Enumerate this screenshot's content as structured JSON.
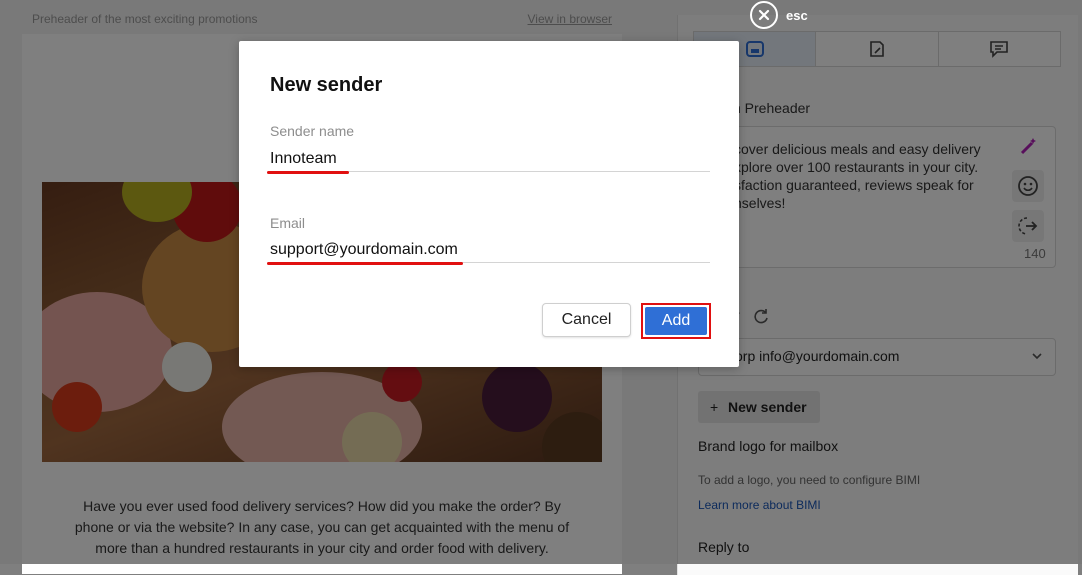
{
  "page": {
    "preheader_label": "Preheader of the most exciting promotions",
    "view_in_browser": "View in browser",
    "email_body": "Have you ever used food delivery services? How did you make the order? By phone or via the website? In any case, you can get acquainted with the menu of more than a hundred restaurants in your city and order food with delivery."
  },
  "sidebar": {
    "tabs": [
      {
        "icon": "content-icon",
        "active": true
      },
      {
        "icon": "design-icon",
        "active": false
      },
      {
        "icon": "comment-icon",
        "active": false
      }
    ],
    "preheader_label": "n Preheader",
    "preheader_text": "cover delicious meals and easy delivery xplore over 100 restaurants in your city. sfaction guaranteed, reviews speak for nselves!",
    "preheader_count": "140",
    "from_label": "r",
    "from_value": "orp  info@yourdomain.com",
    "new_sender_label": "New sender",
    "brand_logo_label": "Brand logo for mailbox",
    "bimi_note": "To add a logo, you need to configure BIMI",
    "bimi_link": "Learn more about BIMI",
    "reply_to_label": "Reply to"
  },
  "overlay": {
    "esc_label": "esc"
  },
  "modal": {
    "title": "New sender",
    "sender_name_label": "Sender name",
    "sender_name_value": "Innoteam",
    "email_label": "Email",
    "email_value": "support@yourdomain.com",
    "cancel_label": "Cancel",
    "add_label": "Add"
  },
  "colors": {
    "accent": "#2f6fd6",
    "highlight": "#e01010"
  }
}
